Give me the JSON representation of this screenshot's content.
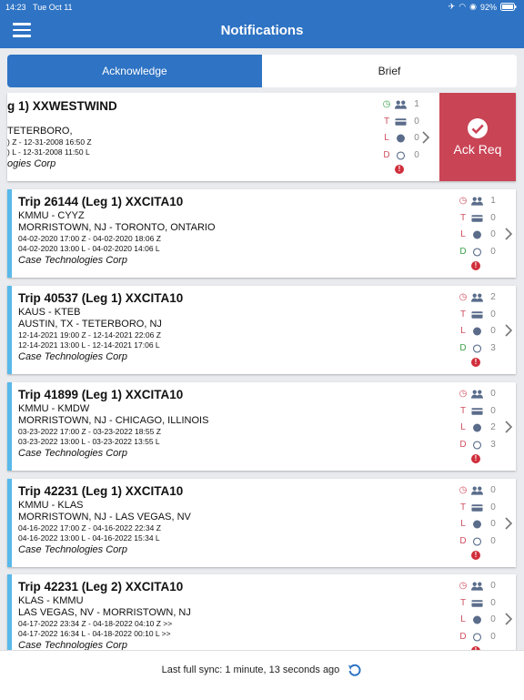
{
  "status_bar": {
    "time": "14:23",
    "date": "Tue Oct 11",
    "battery": "92%"
  },
  "nav": {
    "title": "Notifications"
  },
  "segments": {
    "acknowledge": "Acknowledge",
    "brief": "Brief"
  },
  "swiped_card": {
    "title": "g 1) XXWESTWIND",
    "route_names": "TETERBORO,",
    "zulu_times": ") Z - 12-31-2008 16:50 Z",
    "local_times": ") L - 12-31-2008 11:50 L",
    "company": "ogies Corp",
    "stats": {
      "t_label": "T",
      "l_label": "L",
      "d_label": "D",
      "crew": "1",
      "t": "0",
      "l": "0",
      "d": "0"
    },
    "ack_label": "Ack Req"
  },
  "trips": [
    {
      "title": "Trip 26144 (Leg 1) XXCITA10",
      "airports": "KMMU - CYYZ",
      "cities": "MORRISTOWN, NJ - TORONTO, ONTARIO",
      "zulu_times": "04-02-2020 17:00 Z - 04-02-2020 18:06 Z",
      "local_times": "04-02-2020 13:00 L - 04-02-2020 14:06 L",
      "company": "Case Technologies Corp",
      "t_label": "T",
      "l_label": "L",
      "d_label": "D",
      "crew": "1",
      "t": "0",
      "l": "0",
      "d": "0"
    },
    {
      "title": "Trip 40537 (Leg 1) XXCITA10",
      "airports": "KAUS - KTEB",
      "cities": "AUSTIN, TX - TETERBORO, NJ",
      "zulu_times": "12-14-2021 19:00 Z - 12-14-2021 22:06 Z",
      "local_times": "12-14-2021 13:00 L - 12-14-2021 17:06 L",
      "company": "Case Technologies Corp",
      "t_label": "T",
      "l_label": "L",
      "d_label": "D",
      "crew": "2",
      "t": "0",
      "l": "0",
      "d": "3"
    },
    {
      "title": "Trip 41899 (Leg 1) XXCITA10",
      "airports": "KMMU - KMDW",
      "cities": "MORRISTOWN, NJ - CHICAGO, ILLINOIS",
      "zulu_times": "03-23-2022 17:00 Z - 03-23-2022 18:55 Z",
      "local_times": "03-23-2022 13:00 L - 03-23-2022 13:55 L",
      "company": "Case Technologies Corp",
      "t_label": "T",
      "l_label": "L",
      "d_label": "D",
      "crew": "0",
      "t": "0",
      "l": "2",
      "d": "3"
    },
    {
      "title": "Trip 42231 (Leg 1) XXCITA10",
      "airports": "KMMU - KLAS",
      "cities": "MORRISTOWN, NJ - LAS VEGAS, NV",
      "zulu_times": "04-16-2022 17:00 Z - 04-16-2022 22:34 Z",
      "local_times": "04-16-2022 13:00 L - 04-16-2022 15:34 L",
      "company": "Case Technologies Corp",
      "t_label": "T",
      "l_label": "L",
      "d_label": "D",
      "crew": "0",
      "t": "0",
      "l": "0",
      "d": "0"
    },
    {
      "title": "Trip 42231 (Leg 2) XXCITA10",
      "airports": "KLAS - KMMU",
      "cities": "LAS VEGAS, NV - MORRISTOWN, NJ",
      "zulu_times": "04-17-2022 23:34 Z - 04-18-2022 04:10 Z >>",
      "local_times": "04-17-2022 16:34 L - 04-18-2022 00:10 L >>",
      "company": "Case Technologies Corp",
      "t_label": "T",
      "l_label": "L",
      "d_label": "D",
      "crew": "0",
      "t": "0",
      "l": "0",
      "d": "0"
    }
  ],
  "footer": {
    "sync_text": "Last full sync: 1 minute, 13 seconds ago"
  }
}
